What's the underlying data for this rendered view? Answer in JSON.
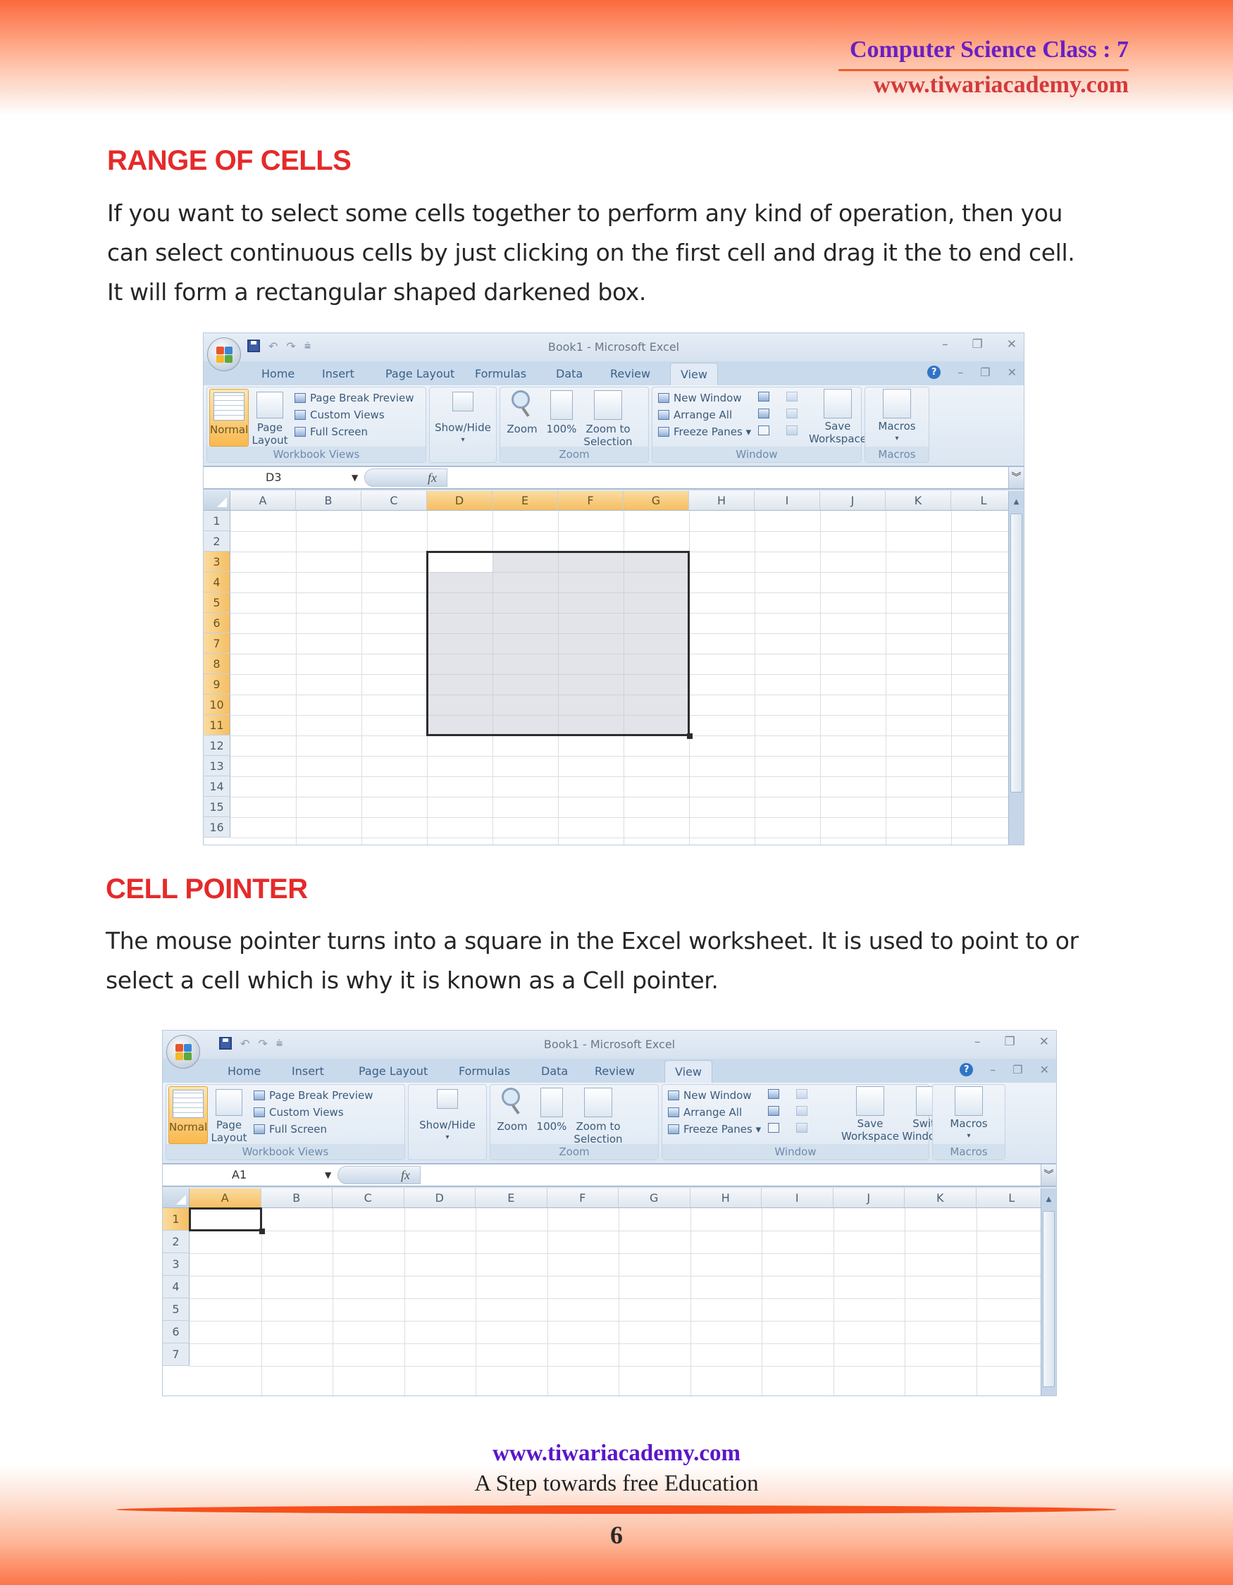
{
  "header": {
    "title": "Computer Science Class : 7",
    "url": "www.tiwariacademy.com"
  },
  "sections": [
    {
      "heading": "RANGE OF CELLS",
      "paragraph_lines": [
        "If you want to select some cells together to perform any kind of operation, then you",
        "can select continuous cells by just clicking on the first cell and drag it the to end cell.",
        "It will form a rectangular shaped darkened box."
      ]
    },
    {
      "heading": "CELL POINTER",
      "paragraph_lines": [
        "The mouse pointer turns into a square in the Excel worksheet. It is used to point to or",
        "select a cell which is why it is known as a Cell pointer."
      ]
    }
  ],
  "excel": {
    "window_title": "Book1 - Microsoft Excel",
    "quick_access": {
      "undo": "↶",
      "redo": "↷",
      "customize": "⩧"
    },
    "window_controls": {
      "minimize": "–",
      "restore": "❐",
      "close": "✕"
    },
    "tabs": [
      "Home",
      "Insert",
      "Page Layout",
      "Formulas",
      "Data",
      "Review",
      "View"
    ],
    "active_tab": "View",
    "help": "?",
    "ribbon": {
      "workbook_views": {
        "label": "Workbook Views",
        "normal": "Normal",
        "page_layout_1": "Page",
        "page_layout_2": "Layout",
        "page_break_preview": "Page Break Preview",
        "custom_views": "Custom Views",
        "full_screen": "Full Screen"
      },
      "show_hide": {
        "label": "Show/Hide",
        "arrow": "▾"
      },
      "zoom": {
        "label": "Zoom",
        "zoom": "Zoom",
        "hundred": "100%",
        "zoom_to_1": "Zoom to",
        "zoom_to_2": "Selection"
      },
      "window": {
        "label": "Window",
        "new_window": "New Window",
        "arrange_all": "Arrange All",
        "freeze_panes": "Freeze Panes ▾",
        "save_1": "Save",
        "save_2": "Workspace",
        "switch_1": "Switch",
        "switch_2": "Windows ▾"
      },
      "macros": {
        "label": "Macros",
        "button": "Macros",
        "arrow": "▾"
      }
    },
    "fx_label": "fx",
    "expand_icon": "»",
    "columns": [
      "A",
      "B",
      "C",
      "D",
      "E",
      "F",
      "G",
      "H",
      "I",
      "J",
      "K",
      "L"
    ],
    "screenshot1": {
      "name_box": "D3",
      "rows": [
        "1",
        "2",
        "3",
        "4",
        "5",
        "6",
        "7",
        "8",
        "9",
        "10",
        "11",
        "12",
        "13",
        "14",
        "15",
        "16"
      ],
      "selected_range": "D3:G11",
      "selected_columns": [
        "D",
        "E",
        "F",
        "G"
      ],
      "selected_rows": [
        "3",
        "4",
        "5",
        "6",
        "7",
        "8",
        "9",
        "10",
        "11"
      ]
    },
    "screenshot2": {
      "name_box": "A1",
      "rows": [
        "1",
        "2",
        "3",
        "4",
        "5",
        "6",
        "7"
      ],
      "active_cell": "A1",
      "selected_columns": [
        "A"
      ],
      "selected_rows": [
        "1"
      ]
    }
  },
  "footer": {
    "url": "www.tiwariacademy.com",
    "tagline": "A Step towards free Education",
    "page_number": "6"
  }
}
